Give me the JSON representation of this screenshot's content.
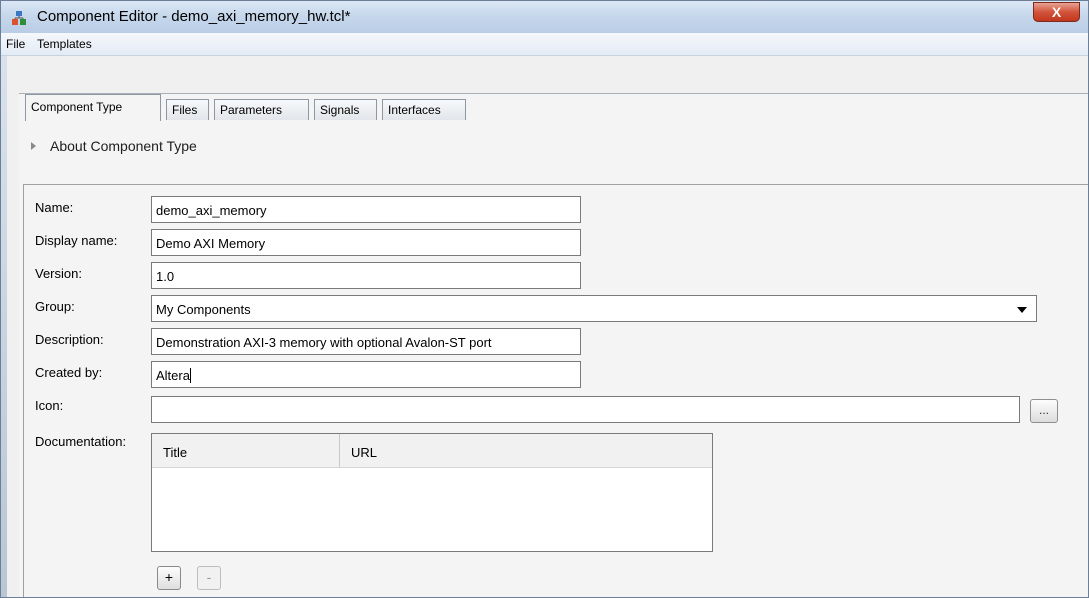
{
  "window": {
    "title": "Component Editor - demo_axi_memory_hw.tcl*",
    "close_glyph": "X"
  },
  "menu": {
    "file": "File",
    "templates": "Templates"
  },
  "tabs": [
    {
      "label": "Component Type",
      "active": true
    },
    {
      "label": "Files",
      "active": false
    },
    {
      "label": "Parameters",
      "active": false
    },
    {
      "label": "Signals",
      "active": false
    },
    {
      "label": "Interfaces",
      "active": false
    }
  ],
  "about": {
    "label": "About Component Type"
  },
  "form": {
    "name_label": "Name:",
    "name_value": "demo_axi_memory",
    "display_name_label": "Display name:",
    "display_name_value": "Demo AXI Memory",
    "version_label": "Version:",
    "version_value": "1.0",
    "group_label": "Group:",
    "group_value": "My Components",
    "description_label": "Description:",
    "description_value": "Demonstration AXI-3 memory with optional Avalon-ST port",
    "created_by_label": "Created by:",
    "created_by_value": "Altera",
    "icon_label": "Icon:",
    "icon_value": "",
    "icon_browse": "...",
    "documentation_label": "Documentation:"
  },
  "documentation_table": {
    "columns": [
      "Title",
      "URL"
    ],
    "rows": []
  },
  "doc_buttons": {
    "add": "+",
    "remove": "-"
  },
  "colors": {
    "titlebar": "#c7d8ec",
    "close_button": "#c1371d",
    "panel": "#f4f4f4"
  }
}
